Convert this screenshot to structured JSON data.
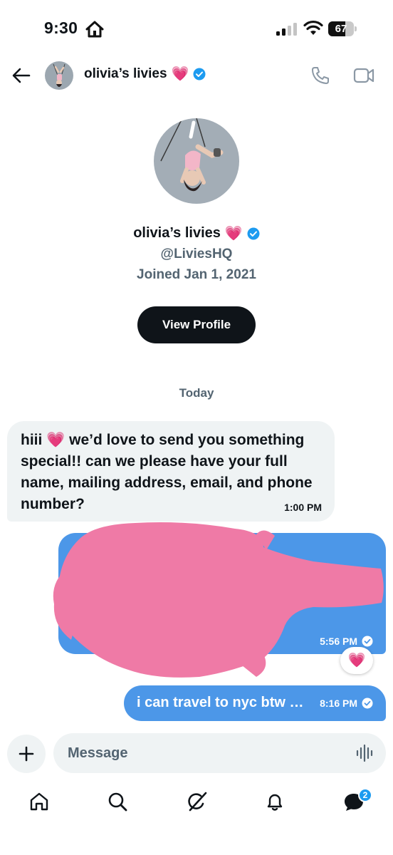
{
  "status_bar": {
    "time": "9:30",
    "battery_level": "67",
    "battery_fraction": 0.67
  },
  "header": {
    "name": "olivia’s livies",
    "name_emoji": "💗",
    "verified": true,
    "icons": [
      "back-arrow-icon",
      "phone-icon",
      "video-camera-icon"
    ]
  },
  "profile": {
    "name": "olivia’s livies",
    "name_emoji": "💗",
    "handle": "@LiviesHQ",
    "joined": "Joined Jan 1, 2021",
    "view_profile_label": "View Profile"
  },
  "conversation": {
    "date_divider": "Today",
    "messages": [
      {
        "direction": "incoming",
        "text": "hiii 💗 we’d love to send you something special!! can we please have your full name, mailing address, email, and phone number?",
        "time": "1:00 PM"
      },
      {
        "direction": "outgoing",
        "text": "",
        "redacted": true,
        "time": "5:56 PM",
        "reaction": "💗"
      },
      {
        "direction": "outgoing",
        "text": "i can travel to nyc btw …",
        "time": "8:16 PM"
      }
    ]
  },
  "composer": {
    "placeholder": "Message"
  },
  "bottom_nav": {
    "items": [
      "home-icon",
      "search-icon",
      "grok-icon",
      "notifications-icon",
      "messages-icon"
    ],
    "messages_badge": "2"
  },
  "colors": {
    "accent": "#1d9bf0",
    "outgoing_bubble": "#4c97e8",
    "incoming_bubble": "#eff3f4",
    "redaction": "#ef7aa6",
    "heart": "#e23fa6"
  }
}
